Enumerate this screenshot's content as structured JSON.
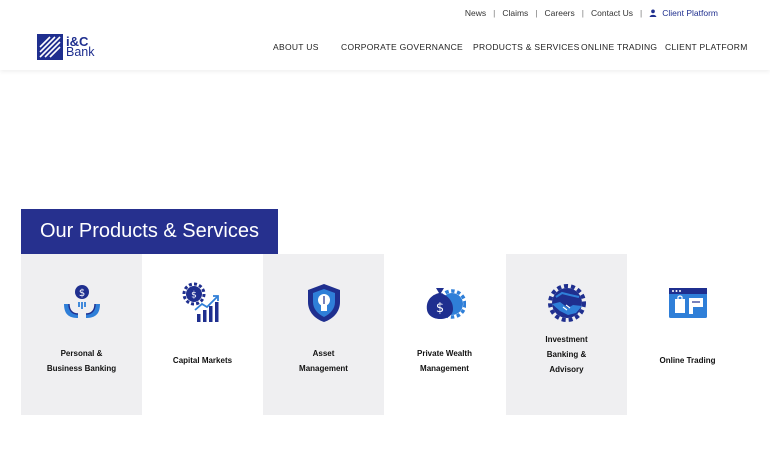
{
  "topbar": {
    "links": [
      "News",
      "Claims",
      "Careers",
      "Contact Us"
    ],
    "client_platform": "Client Platform"
  },
  "logo": {
    "brand": "i&C",
    "bank": "Bank"
  },
  "nav": [
    "ABOUT US",
    "CORPORATE GOVERNANCE",
    "PRODUCTS & SERVICES",
    "ONLINE TRADING",
    "CLIENT PLATFORM"
  ],
  "section": {
    "title": "Our Products & Services"
  },
  "cards": [
    {
      "label": "Personal &\nBusiness Banking",
      "icon": "hands-dollar-icon"
    },
    {
      "label": "Capital Markets",
      "icon": "gear-chart-icon"
    },
    {
      "label": "Asset\nManagement",
      "icon": "shield-bulb-icon"
    },
    {
      "label": "Private Wealth\nManagement",
      "icon": "moneybag-gear-icon"
    },
    {
      "label": "Investment\nBanking &\nAdvisory",
      "icon": "handshake-gear-icon"
    },
    {
      "label": "Online Trading",
      "icon": "browser-shop-icon"
    }
  ],
  "colors": {
    "brand": "#1f2f8f",
    "accent": "#26308e",
    "icon_light": "#2f7fd8",
    "card_bg": "#efeff1"
  }
}
